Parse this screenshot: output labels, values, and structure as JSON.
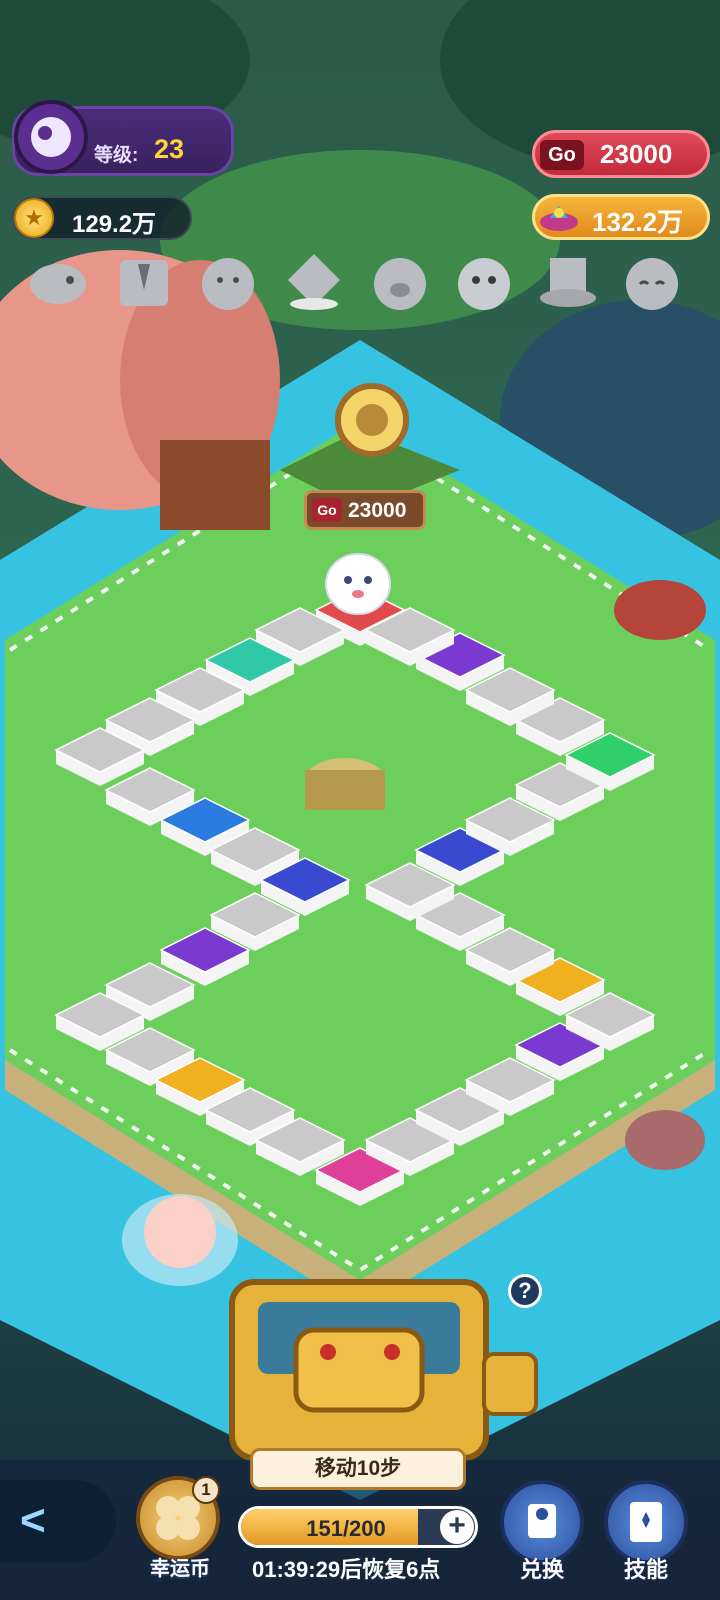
{
  "hud": {
    "level_label": "等级:",
    "level_value": "23",
    "coins": "129.2万",
    "go_currency": "23000",
    "gems": "132.2万"
  },
  "collectibles": [
    "fish-icon",
    "suit-icon",
    "bird-icon",
    "diamond-icon",
    "pig-icon",
    "pufferfish-icon",
    "hat-icon",
    "owl-icon"
  ],
  "board": {
    "sign_value": "23000"
  },
  "bottom": {
    "move_label": "移动10步",
    "lucky_badge": "1",
    "lucky_label": "幸运币",
    "energy_text": "151/200",
    "energy_fraction": 0.755,
    "timer": "01:39:29后恢复6点",
    "exchange_label": "兑换",
    "skill_label": "技能",
    "help": "?"
  },
  "colors": {
    "grass": "#6ccf5b",
    "water": "#34c6e6",
    "tile_gray": "#c9c9c9",
    "go_red": "#d3394a",
    "gem_orange": "#eea02a",
    "level_purple": "#4a2d7a"
  }
}
